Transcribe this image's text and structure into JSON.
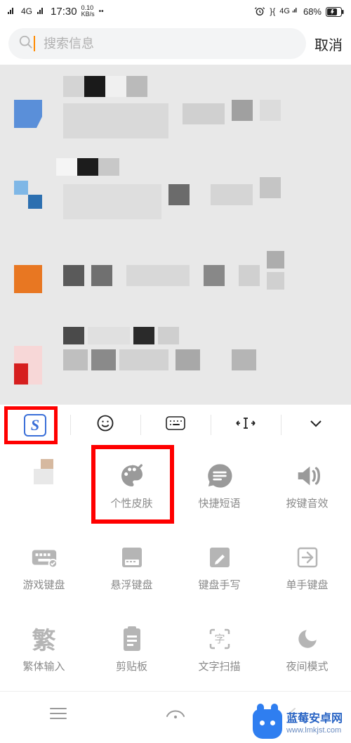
{
  "status": {
    "carrier_left": "4G",
    "time": "17:30",
    "net_speed_top": "0.10",
    "net_speed_unit": "KB/s",
    "vibrate": "}{",
    "cell_right": "4G",
    "battery_pct": "68%"
  },
  "search": {
    "placeholder": "搜索信息",
    "cancel": "取消"
  },
  "keyboard_toolbar": {
    "logo": "S",
    "items": [
      "emoji-icon",
      "keyboard-icon",
      "cursor-move-icon",
      "collapse-icon"
    ]
  },
  "keyboard_grid": [
    {
      "id": "recent",
      "label": "",
      "icon": "recent-icon"
    },
    {
      "id": "skin",
      "label": "个性皮肤",
      "icon": "palette-icon"
    },
    {
      "id": "quickphrase",
      "label": "快捷短语",
      "icon": "chat-lines-icon"
    },
    {
      "id": "keysound",
      "label": "按键音效",
      "icon": "speaker-icon"
    },
    {
      "id": "gamekb",
      "label": "游戏键盘",
      "icon": "game-keyboard-icon"
    },
    {
      "id": "floatkb",
      "label": "悬浮键盘",
      "icon": "float-keyboard-icon"
    },
    {
      "id": "handwrite",
      "label": "键盘手写",
      "icon": "handwrite-icon"
    },
    {
      "id": "onehand",
      "label": "单手键盘",
      "icon": "onehand-icon"
    },
    {
      "id": "traditional",
      "label": "繁体输入",
      "icon": "traditional-icon"
    },
    {
      "id": "clipboard",
      "label": "剪贴板",
      "icon": "clipboard-icon"
    },
    {
      "id": "textscan",
      "label": "文字扫描",
      "icon": "text-scan-icon"
    },
    {
      "id": "nightmode",
      "label": "夜间模式",
      "icon": "moon-icon"
    }
  ],
  "watermark": {
    "title": "蓝莓安卓网",
    "url": "www.lmkjst.com"
  }
}
